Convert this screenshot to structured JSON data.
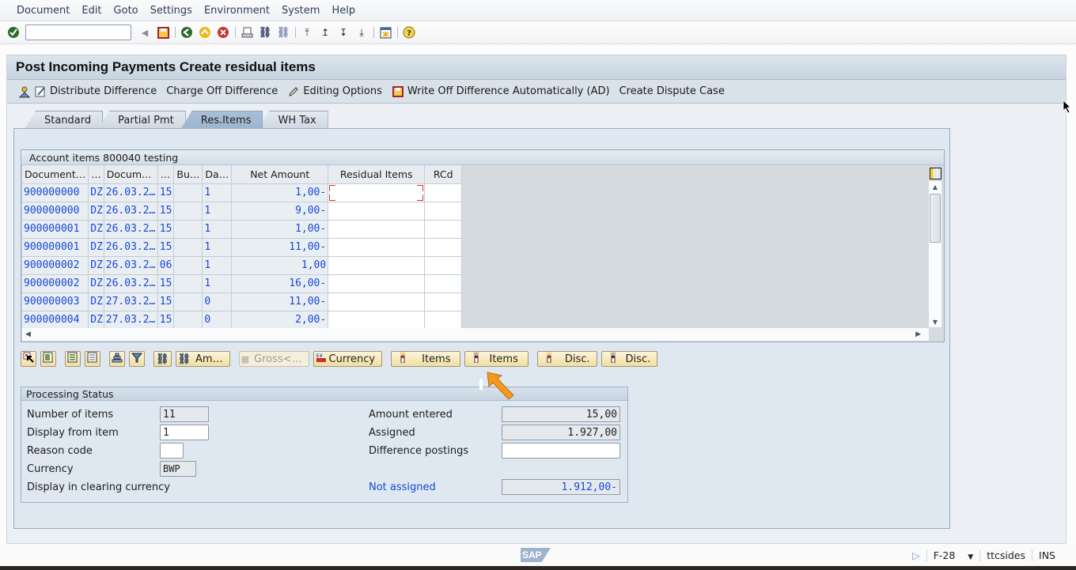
{
  "menu": [
    "Document",
    "Edit",
    "Goto",
    "Settings",
    "Environment",
    "System",
    "Help"
  ],
  "toolbar": {
    "command_field_value": "",
    "icons": [
      "enter-icon",
      "back-nav-icon",
      "save-icon",
      "back-icon",
      "exit-icon",
      "cancel-icon",
      "print-icon",
      "find-icon",
      "find-next-icon",
      "first-page-icon",
      "previous-page-icon",
      "next-page-icon",
      "last-page-icon",
      "layout-icon",
      "help-icon"
    ]
  },
  "page": {
    "title": "Post Incoming Payments Create residual items"
  },
  "app_toolbar": [
    {
      "label": "Distribute Difference",
      "icon": "distribute-icon"
    },
    {
      "label": "Charge Off Difference",
      "icon": ""
    },
    {
      "label": "Editing Options",
      "icon": "pencil-icon"
    },
    {
      "label": "Write Off Difference Automatically (AD)",
      "icon": "write-off-icon"
    },
    {
      "label": "Create Dispute Case",
      "icon": ""
    }
  ],
  "tabs": [
    {
      "label": "Standard",
      "active": false
    },
    {
      "label": "Partial Pmt",
      "active": false
    },
    {
      "label": "Res.Items",
      "active": true
    },
    {
      "label": "WH Tax",
      "active": false
    }
  ],
  "items_table": {
    "caption": "Account items 800040 testing",
    "columns": [
      "Document…",
      "…",
      "Docum…",
      "…",
      "Bu…",
      "Da…",
      "Net Amount",
      "Residual Items",
      "RCd"
    ],
    "rows": [
      {
        "doc": "900000000",
        "type": "DZ",
        "date": "26.03.2…",
        "key": "15",
        "bu": "",
        "days": "1",
        "net": "1,00-",
        "residual": "",
        "rcd": ""
      },
      {
        "doc": "900000000",
        "type": "DZ",
        "date": "26.03.2…",
        "key": "15",
        "bu": "",
        "days": "1",
        "net": "9,00-",
        "residual": "",
        "rcd": ""
      },
      {
        "doc": "900000001",
        "type": "DZ",
        "date": "26.03.2…",
        "key": "15",
        "bu": "",
        "days": "1",
        "net": "1,00-",
        "residual": "",
        "rcd": ""
      },
      {
        "doc": "900000001",
        "type": "DZ",
        "date": "26.03.2…",
        "key": "15",
        "bu": "",
        "days": "1",
        "net": "11,00-",
        "residual": "",
        "rcd": ""
      },
      {
        "doc": "900000002",
        "type": "DZ",
        "date": "26.03.2…",
        "key": "06",
        "bu": "",
        "days": "1",
        "net": "1,00",
        "residual": "",
        "rcd": ""
      },
      {
        "doc": "900000002",
        "type": "DZ",
        "date": "26.03.2…",
        "key": "15",
        "bu": "",
        "days": "1",
        "net": "16,00-",
        "residual": "",
        "rcd": ""
      },
      {
        "doc": "900000003",
        "type": "DZ",
        "date": "27.03.2…",
        "key": "15",
        "bu": "",
        "days": "0",
        "net": "11,00-",
        "residual": "",
        "rcd": ""
      },
      {
        "doc": "900000004",
        "type": "DZ",
        "date": "27.03.2…",
        "key": "15",
        "bu": "",
        "days": "0",
        "net": "2,00-",
        "residual": "",
        "rcd": ""
      }
    ]
  },
  "table_buttons": {
    "amount_label": "Am…",
    "gross_label": "Gross<…",
    "currency_label": "Currency",
    "activate_items_label": "Items",
    "deactivate_items_label": "Items",
    "activate_disc_label": "Disc.",
    "deactivate_disc_label": "Disc."
  },
  "processing_status": {
    "caption": "Processing Status",
    "number_of_items_label": "Number of items",
    "number_of_items_value": "11",
    "display_from_item_label": "Display from item",
    "display_from_item_value": "1",
    "reason_code_label": "Reason code",
    "reason_code_value": "",
    "currency_label": "Currency",
    "currency_value": "BWP",
    "display_clearing_label": "Display in clearing currency",
    "amount_entered_label": "Amount entered",
    "amount_entered_value": "15,00",
    "assigned_label": "Assigned",
    "assigned_value": "1.927,00",
    "difference_postings_label": "Difference postings",
    "difference_postings_value": "",
    "not_assigned_label": "Not assigned",
    "not_assigned_value": "1.912,00-"
  },
  "status_bar": {
    "logo": "SAP",
    "transaction": "F-28",
    "server": "ttcsides",
    "mode": "INS"
  },
  "colors": {
    "link_blue": "#1848d8",
    "button_yellow": "#f1dea2",
    "annotation_arrow": "#f39a1e",
    "focus_red": "#d13a2b"
  }
}
